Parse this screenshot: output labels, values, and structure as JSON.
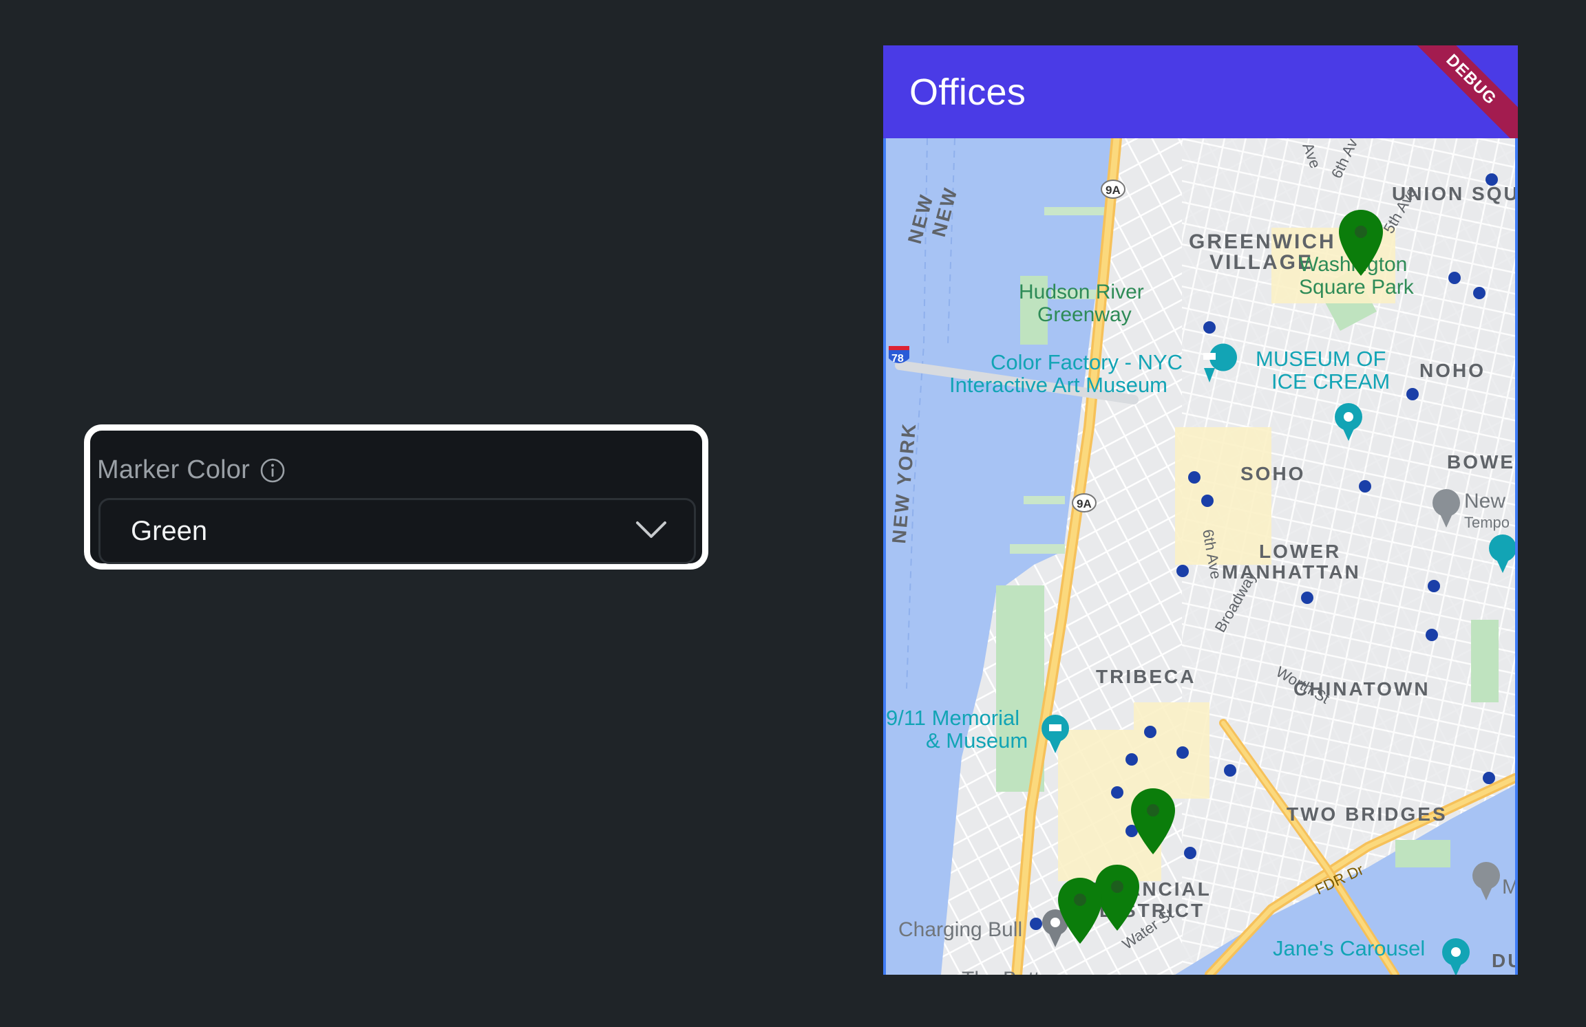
{
  "property": {
    "label": "Marker Color",
    "info_icon": "info-icon",
    "selected_value": "Green",
    "chevron_icon": "chevron-down-icon"
  },
  "app": {
    "title": "Offices",
    "debug_label": "DEBUG"
  },
  "map": {
    "marker_color": "#0b7d0b",
    "labels": {
      "union_square": "UNION SQU",
      "greenwich_village": [
        "GREENWICH",
        "VILLAGE"
      ],
      "washington_square_park": [
        "Washington",
        "Square Park"
      ],
      "noho": "NOHO",
      "hudson_river_greenway": [
        "Hudson River",
        "Greenway"
      ],
      "color_factory": [
        "Color Factory - NYC",
        "Interactive Art Museum"
      ],
      "museum_of_ice_cream": [
        "MUSEUM OF",
        "ICE CREAM"
      ],
      "soho": "SOHO",
      "bowery": "BOWEI",
      "new_temple": [
        "New",
        "Tempo"
      ],
      "lower_manhattan": [
        "LOWER",
        "MANHATTAN"
      ],
      "tribeca": "TRIBECA",
      "chinatown": "CHINATOWN",
      "memorial_911": [
        "9/11 Memorial",
        "& Museum"
      ],
      "two_bridges": "TWO BRIDGES",
      "financial_district": [
        "FINANCIAL",
        "DISTRICT"
      ],
      "charging_bull": "Charging Bull",
      "fdr_dr": "FDR Dr",
      "janes_carousel": "Jane's Carousel",
      "water_st": "Water St",
      "worth_st": "Worth St",
      "broadway": "Broadway",
      "sixth_ave": "6th Ave",
      "fifth_ave": "5th Ave",
      "sixth_av_top": "6th Av",
      "ave": "Ave",
      "new_york_river": "NEW YORK",
      "new_jersey": [
        "NEW",
        "NEW"
      ],
      "route_9a": "9A",
      "route_78": "78",
      "the_battery": "The Battery",
      "du": "DU",
      "m_edge": "M"
    }
  }
}
